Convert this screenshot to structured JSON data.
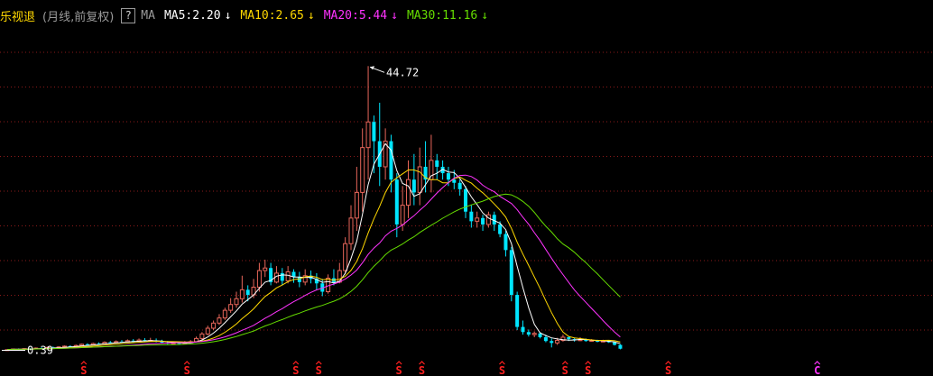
{
  "header": {
    "title": "乐视退",
    "subtitle": "(月线,前复权)",
    "help": "?",
    "ma_label": "MA",
    "items": [
      {
        "text": "MA5:2.20",
        "arrow": "↓",
        "color": "#ffffff"
      },
      {
        "text": "MA10:2.65",
        "arrow": "↓",
        "color": "#ffd800"
      },
      {
        "text": "MA20:5.44",
        "arrow": "↓",
        "color": "#ff33ff"
      },
      {
        "text": "MA30:11.16",
        "arrow": "↓",
        "color": "#66dd00"
      }
    ]
  },
  "chart_data": {
    "type": "candlestick",
    "annotations": {
      "high": "44.72",
      "low": "0.39"
    },
    "ylim": [
      0,
      48
    ],
    "colors": {
      "up": "#e8665a",
      "down": "#00e5ff",
      "ma5": "#ffffff",
      "ma10": "#ffd800",
      "ma20": "#ff33ff",
      "ma30": "#66dd00",
      "grid": "#8b1a1a",
      "signal": "#ff2020",
      "signal_c": "#ff33ff"
    },
    "candles": [
      [
        0.39,
        0.45,
        0.35,
        0.5
      ],
      [
        0.45,
        0.55,
        0.42,
        0.6
      ],
      [
        0.55,
        0.5,
        0.45,
        0.65
      ],
      [
        0.5,
        0.62,
        0.48,
        0.7
      ],
      [
        0.62,
        0.58,
        0.52,
        0.72
      ],
      [
        0.58,
        0.7,
        0.55,
        0.8
      ],
      [
        0.7,
        0.66,
        0.6,
        0.85
      ],
      [
        0.66,
        0.8,
        0.62,
        0.9
      ],
      [
        0.8,
        0.75,
        0.7,
        0.95
      ],
      [
        0.75,
        0.88,
        0.72,
        1.0
      ],
      [
        0.88,
        1.0,
        0.8,
        1.1
      ],
      [
        1.0,
        0.95,
        0.85,
        1.15
      ],
      [
        0.95,
        1.1,
        0.9,
        1.25
      ],
      [
        1.1,
        1.3,
        1.0,
        1.4
      ],
      [
        1.3,
        1.2,
        1.1,
        1.45
      ],
      [
        1.2,
        1.4,
        1.15,
        1.55
      ],
      [
        1.4,
        1.35,
        1.25,
        1.6
      ],
      [
        1.35,
        1.6,
        1.3,
        1.75
      ],
      [
        1.6,
        1.55,
        1.45,
        1.8
      ],
      [
        1.55,
        1.7,
        1.5,
        1.9
      ],
      [
        1.7,
        1.65,
        1.55,
        1.95
      ],
      [
        1.65,
        1.85,
        1.6,
        2.05
      ],
      [
        1.85,
        1.75,
        1.65,
        2.1
      ],
      [
        1.75,
        1.95,
        1.7,
        2.2
      ],
      [
        1.95,
        1.85,
        1.7,
        2.25
      ],
      [
        1.85,
        1.9,
        1.7,
        2.3
      ],
      [
        1.9,
        1.7,
        1.6,
        2.2
      ],
      [
        1.7,
        1.55,
        1.45,
        2.0
      ],
      [
        1.55,
        1.4,
        1.3,
        1.8
      ],
      [
        1.4,
        1.5,
        1.35,
        1.7
      ],
      [
        1.5,
        1.45,
        1.35,
        1.7
      ],
      [
        1.45,
        1.55,
        1.4,
        1.8
      ],
      [
        1.55,
        1.7,
        1.5,
        1.95
      ],
      [
        1.7,
        2.2,
        1.65,
        2.5
      ],
      [
        2.2,
        2.9,
        2.0,
        3.2
      ],
      [
        2.9,
        3.8,
        2.7,
        4.2
      ],
      [
        3.8,
        4.6,
        3.5,
        5.0
      ],
      [
        4.6,
        5.4,
        4.3,
        6.0
      ],
      [
        5.4,
        6.6,
        5.1,
        7.0
      ],
      [
        6.6,
        7.5,
        6.2,
        8.5
      ],
      [
        7.5,
        8.4,
        7.0,
        9.5
      ],
      [
        8.4,
        9.8,
        7.8,
        12.0
      ],
      [
        9.8,
        9.0,
        8.0,
        10.5
      ],
      [
        9.0,
        10.2,
        8.5,
        11.5
      ],
      [
        10.2,
        12.8,
        9.5,
        14.0
      ],
      [
        12.8,
        13.2,
        11.8,
        14.5
      ],
      [
        13.2,
        11.0,
        10.5,
        14.0
      ],
      [
        11.0,
        12.4,
        10.8,
        13.5
      ],
      [
        12.4,
        11.2,
        10.5,
        13.2
      ],
      [
        11.2,
        12.6,
        10.8,
        13.5
      ],
      [
        12.6,
        11.8,
        10.9,
        13.0
      ],
      [
        11.8,
        11.0,
        10.2,
        12.6
      ],
      [
        11.0,
        12.0,
        10.5,
        13.0
      ],
      [
        12.0,
        11.5,
        10.8,
        12.8
      ],
      [
        11.5,
        10.8,
        9.8,
        12.4
      ],
      [
        10.8,
        9.5,
        8.8,
        11.5
      ],
      [
        9.5,
        11.6,
        9.2,
        12.2
      ],
      [
        11.6,
        11.0,
        10.5,
        13.0
      ],
      [
        11.0,
        12.8,
        10.8,
        14.0
      ],
      [
        12.8,
        17.0,
        12.2,
        18.0
      ],
      [
        17.0,
        21.0,
        16.0,
        23.0
      ],
      [
        21.0,
        25.0,
        19.0,
        29.0
      ],
      [
        25.0,
        32.0,
        22.0,
        35.0
      ],
      [
        32.0,
        36.0,
        27.0,
        44.72
      ],
      [
        36.0,
        33.0,
        28.0,
        37.0
      ],
      [
        33.0,
        29.0,
        26.0,
        39.0
      ],
      [
        29.0,
        33.0,
        27.0,
        35.0
      ],
      [
        33.0,
        27.0,
        25.0,
        34.0
      ],
      [
        27.0,
        20.0,
        18.0,
        28.0
      ],
      [
        20.0,
        23.0,
        19.0,
        26.0
      ],
      [
        23.0,
        27.0,
        21.0,
        30.0
      ],
      [
        27.0,
        25.0,
        23.0,
        31.0
      ],
      [
        25.0,
        29.0,
        23.0,
        32.0
      ],
      [
        29.0,
        27.0,
        25.0,
        33.0
      ],
      [
        27.0,
        30.0,
        25.0,
        34.0
      ],
      [
        30.0,
        29.0,
        27.0,
        31.0
      ],
      [
        29.0,
        28.0,
        27.0,
        30.0
      ],
      [
        28.0,
        27.0,
        26.0,
        29.0
      ],
      [
        27.0,
        26.5,
        25.5,
        28.5
      ],
      [
        26.5,
        25.5,
        24.5,
        27.0
      ],
      [
        25.5,
        22.0,
        21.0,
        26.0
      ],
      [
        22.0,
        20.5,
        19.5,
        23.0
      ],
      [
        20.5,
        21.0,
        19.5,
        22.0
      ],
      [
        21.0,
        20.0,
        19.0,
        21.5
      ],
      [
        20.0,
        21.5,
        19.5,
        22.0
      ],
      [
        21.5,
        20.0,
        19.0,
        22.0
      ],
      [
        20.0,
        18.5,
        18.0,
        20.5
      ],
      [
        18.5,
        16.0,
        15.0,
        19.0
      ],
      [
        16.0,
        9.0,
        8.0,
        16.5
      ],
      [
        9.0,
        4.0,
        3.5,
        9.5
      ],
      [
        4.0,
        3.2,
        2.8,
        5.0
      ],
      [
        3.2,
        2.8,
        2.5,
        3.6
      ],
      [
        2.8,
        3.0,
        2.4,
        3.3
      ],
      [
        3.0,
        2.4,
        2.2,
        3.2
      ],
      [
        2.4,
        1.8,
        1.6,
        2.8
      ],
      [
        1.8,
        1.5,
        0.8,
        2.2
      ],
      [
        1.5,
        1.9,
        1.2,
        2.3
      ],
      [
        1.9,
        2.4,
        1.7,
        2.8
      ],
      [
        2.4,
        2.1,
        1.8,
        2.6
      ],
      [
        2.1,
        1.9,
        1.7,
        2.3
      ],
      [
        1.9,
        2.0,
        1.8,
        2.4
      ],
      [
        2.0,
        1.8,
        1.7,
        2.2
      ],
      [
        1.8,
        1.9,
        1.7,
        2.1
      ],
      [
        1.9,
        1.7,
        1.6,
        2.0
      ],
      [
        1.7,
        1.8,
        1.6,
        2.0
      ],
      [
        1.8,
        1.6,
        1.5,
        1.9
      ],
      [
        1.6,
        1.2,
        1.1,
        1.7
      ],
      [
        1.2,
        0.6,
        0.5,
        1.3
      ]
    ],
    "signals": [
      {
        "index": 14,
        "label": "S",
        "kind": "S"
      },
      {
        "index": 32,
        "label": "S",
        "kind": "S"
      },
      {
        "index": 51,
        "label": "S",
        "kind": "S"
      },
      {
        "index": 55,
        "label": "S",
        "kind": "S"
      },
      {
        "index": 69,
        "label": "S",
        "kind": "S"
      },
      {
        "index": 73,
        "label": "S",
        "kind": "S"
      },
      {
        "index": 87,
        "label": "S",
        "kind": "S"
      },
      {
        "index": 98,
        "label": "S",
        "kind": "S"
      },
      {
        "index": 102,
        "label": "S",
        "kind": "S"
      },
      {
        "index": 116,
        "label": "S",
        "kind": "S"
      },
      {
        "index": 142,
        "label": "C",
        "kind": "C"
      }
    ]
  }
}
